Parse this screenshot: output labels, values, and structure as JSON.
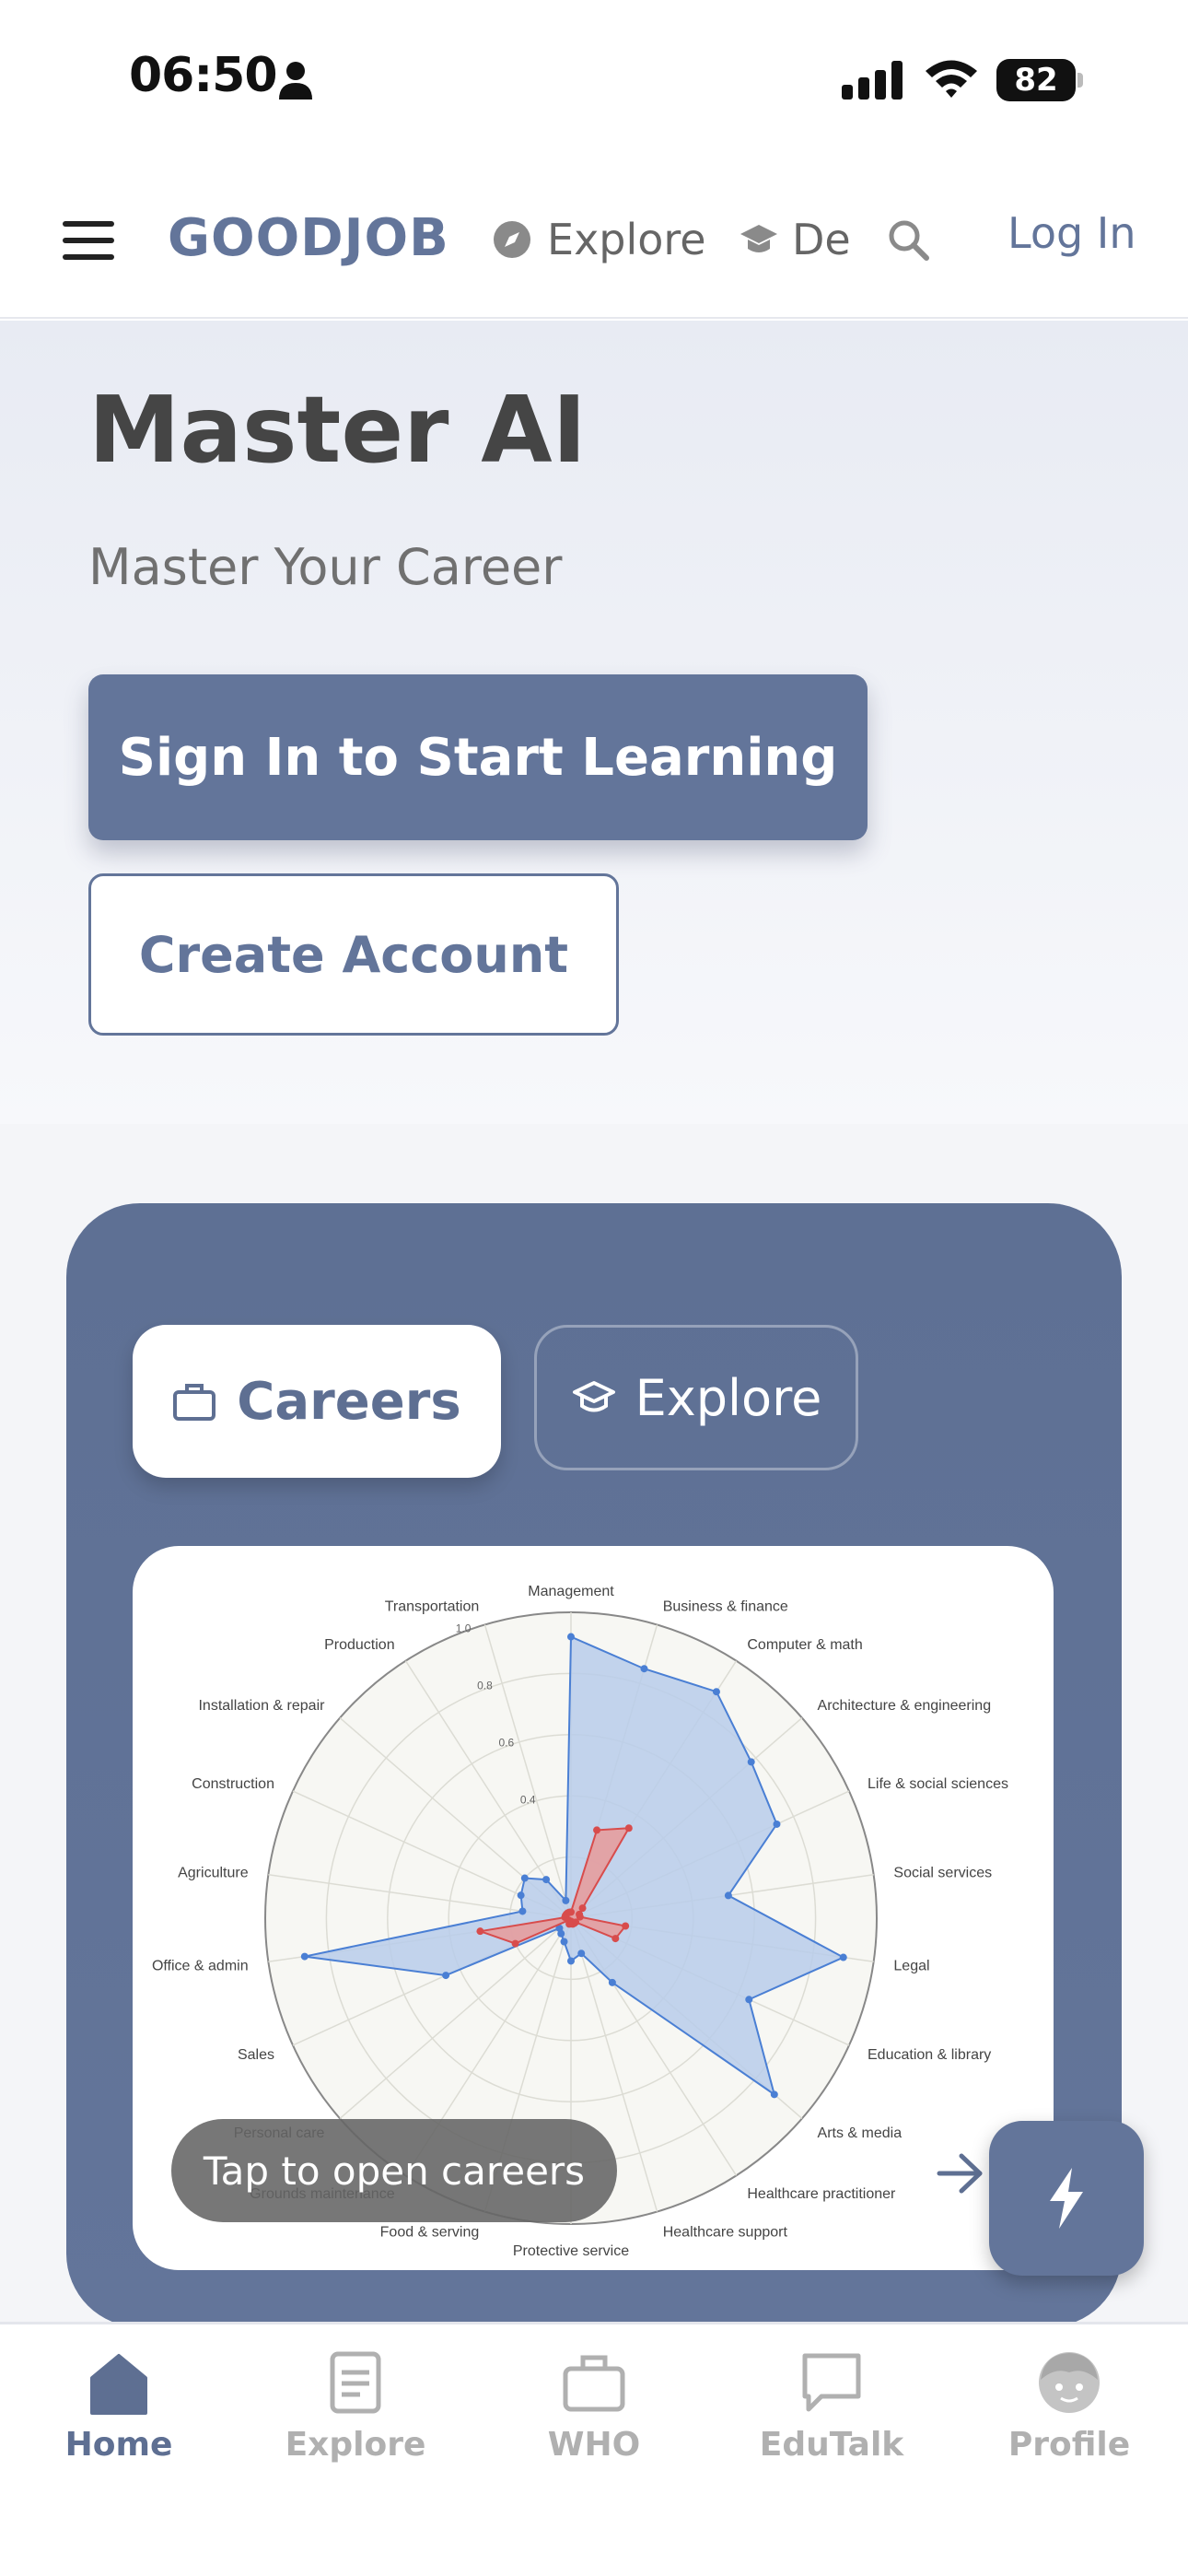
{
  "status_bar": {
    "time": "06:50",
    "battery": "82"
  },
  "header": {
    "logo": "GOODJOB",
    "nav_explore": "Explore",
    "nav_de": "De",
    "login": "Log In"
  },
  "hero": {
    "title": "Master AI",
    "subtitle": "Master Your Career",
    "primary_button": "Sign In to Start Learning",
    "secondary_button": "Create Account"
  },
  "card": {
    "tab_careers": "Careers",
    "tab_explore": "Explore",
    "tooltip": "Tap to open careers"
  },
  "chart_data": {
    "type": "radar",
    "categories": [
      "Management",
      "Business & finance",
      "Computer & math",
      "Architecture & engineering",
      "Life & social sciences",
      "Social services",
      "Legal",
      "Education & library",
      "Arts & media",
      "Healthcare practitioner",
      "Healthcare support",
      "Protective service",
      "Food & serving",
      "Grounds maintenance",
      "Personal care",
      "Sales",
      "Office & admin",
      "Agriculture",
      "Construction",
      "Installation & repair",
      "Production",
      "Transportation"
    ],
    "rlim": [
      0,
      1.0
    ],
    "r_ticks": [
      "0.4",
      "0.6",
      "0.8",
      "1.0"
    ],
    "series": [
      {
        "color": "#4a7fd4",
        "fill": "#b9cdea",
        "values": [
          0.92,
          0.85,
          0.88,
          0.78,
          0.74,
          0.52,
          0.9,
          0.64,
          0.88,
          0.25,
          0.12,
          0.14,
          0.08,
          0.06,
          0.05,
          0.45,
          0.88,
          0.16,
          0.18,
          0.2,
          0.15,
          0.06
        ]
      },
      {
        "color": "#d84c4c",
        "fill": "#e79a9a",
        "values": [
          0.02,
          0.3,
          0.35,
          0.05,
          0.03,
          0.03,
          0.18,
          0.16,
          0.02,
          0.02,
          0.02,
          0.01,
          0.02,
          0.01,
          0.01,
          0.2,
          0.3,
          0.02,
          0.02,
          0.02,
          0.02,
          0.02
        ]
      }
    ],
    "grid": true
  },
  "bottom_nav": {
    "items": [
      {
        "label": "Home"
      },
      {
        "label": "Explore"
      },
      {
        "label": "WHO"
      },
      {
        "label": "EduTalk"
      },
      {
        "label": "Profile"
      }
    ]
  },
  "colors": {
    "accent": "#63759a",
    "blue_series": "#4a7fd4",
    "red_series": "#d84c4c"
  }
}
